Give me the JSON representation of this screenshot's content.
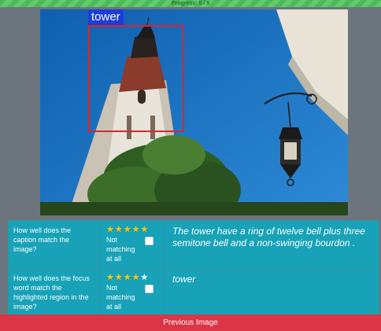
{
  "progress": {
    "label": "Progress: 5 / 5",
    "fraction": 1.0,
    "color": "#5fcb6b"
  },
  "image": {
    "focus_label": "tower",
    "box_color": "#d9262e",
    "tag_color": "#1c3ed8"
  },
  "ratings": [
    {
      "question": "How well does the caption match the image?",
      "stars_filled": 5,
      "stars_total": 5,
      "not_matching_label": "Not matching at all",
      "response": "The tower have a ring of twelve bell plus three semitone bell and a non-swinging bourdon ."
    },
    {
      "question": "How well does the focus word match the highlighted region in the image?",
      "stars_filled": 4,
      "stars_total": 5,
      "not_matching_label": "Not matching at all",
      "response": "tower"
    }
  ],
  "buttons": {
    "previous_label": "Previous Image"
  },
  "colors": {
    "accent": "#17a2b8",
    "danger": "#dc3545",
    "star": "#f5c518"
  },
  "icons": {
    "star": "star-icon",
    "checkbox": "checkbox-icon"
  }
}
